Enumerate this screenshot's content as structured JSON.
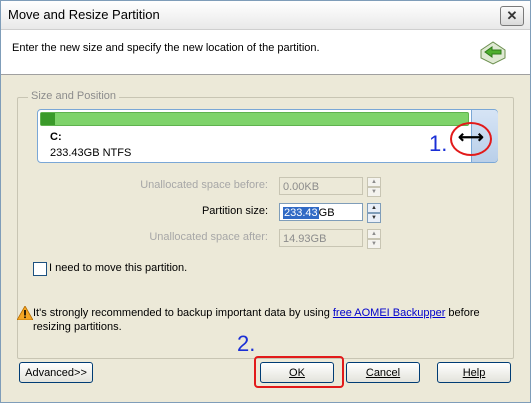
{
  "window": {
    "title": "Move and Resize Partition"
  },
  "header": {
    "instruction": "Enter the new size and specify the new location of the partition."
  },
  "group": {
    "label": "Size and Position"
  },
  "partition": {
    "drive_letter": "C:",
    "info": "233.43GB NTFS"
  },
  "annotations": {
    "step1": "1.",
    "step2": "2."
  },
  "fields": {
    "before": {
      "label": "Unallocated space before:",
      "value": "0.00KB"
    },
    "size": {
      "label": "Partition size:",
      "value_selected": "233.43",
      "unit": "GB"
    },
    "after": {
      "label": "Unallocated space after:",
      "value": "14.93GB"
    }
  },
  "checkbox": {
    "label": "I need to move this partition.",
    "checked": false
  },
  "warning": {
    "text_before": "It's strongly recommended to backup important data by using ",
    "link": "free AOMEI Backupper",
    "text_after": " before resizing partitions."
  },
  "buttons": {
    "advanced": "Advanced>>",
    "ok": "OK",
    "cancel": "Cancel",
    "help": "Help"
  },
  "icons": {
    "close": "close-icon",
    "header": "move-arrow-icon",
    "warning": "warning-icon",
    "resize": "resize-arrows-icon"
  },
  "colors": {
    "partition_bar": "#7ed36a",
    "used_space": "#3a9a2a",
    "annotation_blue": "#1a2fd6",
    "highlight_red": "#e21a1a"
  }
}
